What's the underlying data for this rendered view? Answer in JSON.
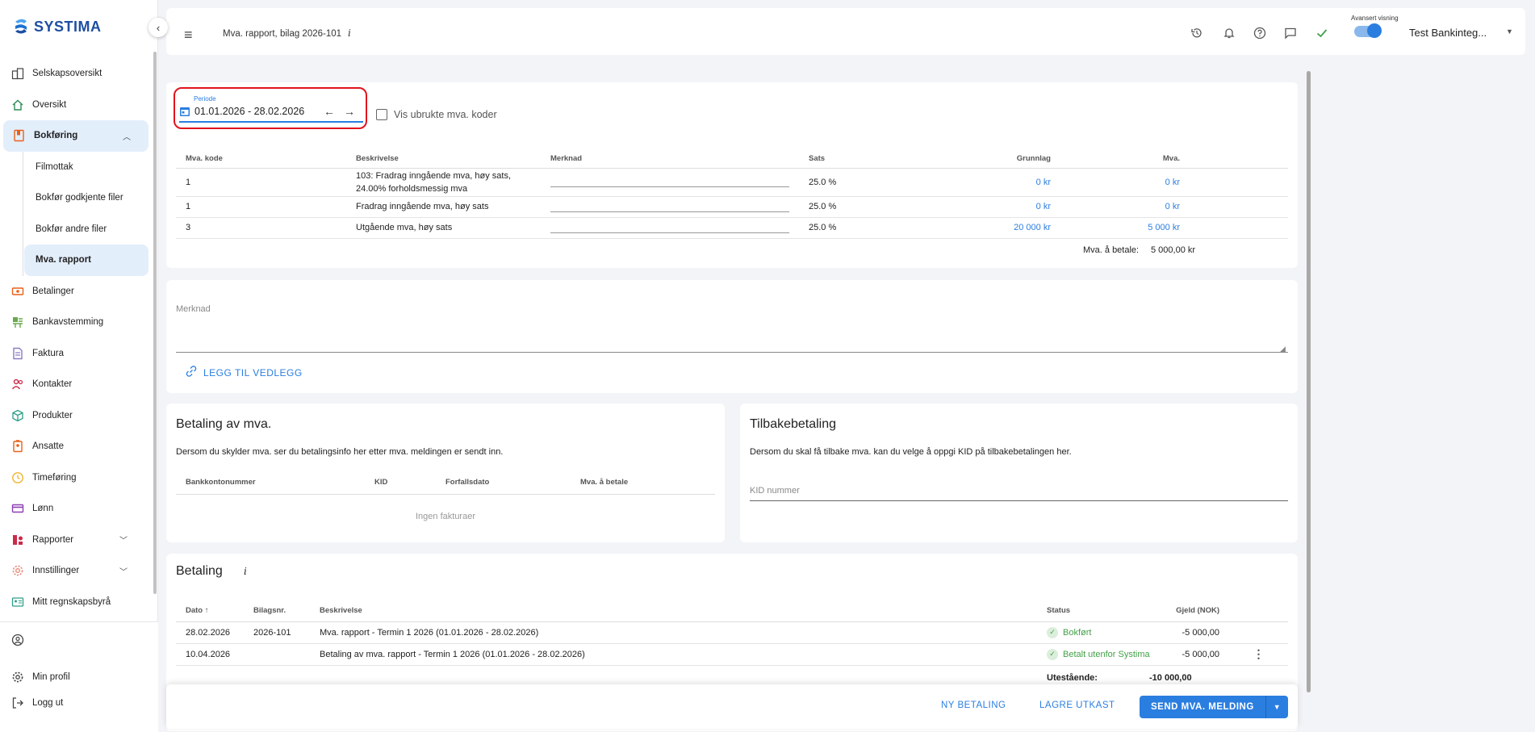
{
  "app": {
    "name": "SYSTIMA"
  },
  "colors": {
    "accent": "#2a7ee0",
    "brand": "#1d4ea3",
    "highlight": "#e0141e",
    "success": "#43a047"
  },
  "sidebar": {
    "items": [
      {
        "label": "Selskapsoversikt",
        "icon": "building-icon"
      },
      {
        "label": "Oversikt",
        "icon": "home-icon"
      },
      {
        "label": "Bokføring",
        "icon": "ledger-icon",
        "expanded": true
      },
      {
        "label": "Betalinger",
        "icon": "payments-icon"
      },
      {
        "label": "Bankavstemming",
        "icon": "bank-reconcile-icon"
      },
      {
        "label": "Faktura",
        "icon": "invoice-icon"
      },
      {
        "label": "Kontakter",
        "icon": "contacts-icon"
      },
      {
        "label": "Produkter",
        "icon": "product-icon"
      },
      {
        "label": "Ansatte",
        "icon": "employees-icon"
      },
      {
        "label": "Timeføring",
        "icon": "clock-icon"
      },
      {
        "label": "Lønn",
        "icon": "salary-icon"
      },
      {
        "label": "Rapporter",
        "icon": "reports-icon"
      },
      {
        "label": "Innstillinger",
        "icon": "settings-icon"
      },
      {
        "label": "Mitt regnskapsbyrå",
        "icon": "agency-icon"
      }
    ],
    "subitems": [
      "Filmottak",
      "Bokfør godkjente filer",
      "Bokfør andre filer",
      "Mva. rapport"
    ],
    "bottom": {
      "profile": "Min profil",
      "logout": "Logg ut"
    }
  },
  "header": {
    "breadcrumb": "Mva. rapport, bilag 2026-101",
    "info": "i",
    "toggle_label": "Avansert visning",
    "user": "Test Bankinteg..."
  },
  "period": {
    "label": "Periode",
    "value": "01.01.2026 - 28.02.2026",
    "checkbox_label": "Vis ubrukte mva. koder"
  },
  "vat_table": {
    "headers": [
      "Mva. kode",
      "Beskrivelse",
      "Merknad",
      "Sats",
      "Grunnlag",
      "Mva."
    ],
    "rows": [
      {
        "code": "1",
        "desc1": "103: Fradrag inngående mva, høy sats,",
        "desc2": "24.00% forholdsmessig mva",
        "rate": "25.0 %",
        "base": "0 kr",
        "vat": "0 kr"
      },
      {
        "code": "1",
        "desc1": "Fradrag inngående mva, høy sats",
        "desc2": "",
        "rate": "25.0 %",
        "base": "0 kr",
        "vat": "0 kr"
      },
      {
        "code": "3",
        "desc1": "Utgående mva, høy sats",
        "desc2": "",
        "rate": "25.0 %",
        "base": "20 000 kr",
        "vat": "5 000 kr"
      }
    ],
    "sum_label": "Mva. å betale:",
    "sum_value": "5 000,00 kr"
  },
  "note": {
    "label": "Merknad",
    "attach": "LEGG TIL VEDLEGG"
  },
  "payment": {
    "title": "Betaling av mva.",
    "desc": "Dersom du skylder mva. ser du betalingsinfo her etter mva. meldingen er sendt inn.",
    "headers": [
      "Bankkontonummer",
      "KID",
      "Forfallsdato",
      "Mva. å betale"
    ],
    "empty": "Ingen fakturaer"
  },
  "refund": {
    "title": "Tilbakebetaling",
    "desc": "Dersom du skal få tilbake mva. kan du velge å oppgi KID på tilbakebetalingen her.",
    "kid_placeholder": "KID nummer"
  },
  "betaling": {
    "title": "Betaling",
    "info": "i",
    "headers": {
      "date": "Dato",
      "voucher": "Bilagsnr.",
      "desc": "Beskrivelse",
      "status": "Status",
      "debt": "Gjeld (NOK)"
    },
    "rows": [
      {
        "date": "28.02.2026",
        "voucher": "2026-101",
        "desc": "Mva. rapport - Termin 1 2026 (01.01.2026 - 28.02.2026)",
        "status": "Bokført",
        "debt": "-5 000,00"
      },
      {
        "date": "10.04.2026",
        "voucher": "",
        "desc": "Betaling av mva. rapport - Termin 1 2026 (01.01.2026 - 28.02.2026)",
        "status": "Betalt utenfor Systima",
        "debt": "-5 000,00"
      }
    ],
    "outstanding_label": "Utestående:",
    "outstanding_value": "-10 000,00"
  },
  "footer": {
    "new_payment": "NY BETALING",
    "save_draft": "LAGRE UTKAST",
    "send": "SEND MVA. MELDING"
  }
}
